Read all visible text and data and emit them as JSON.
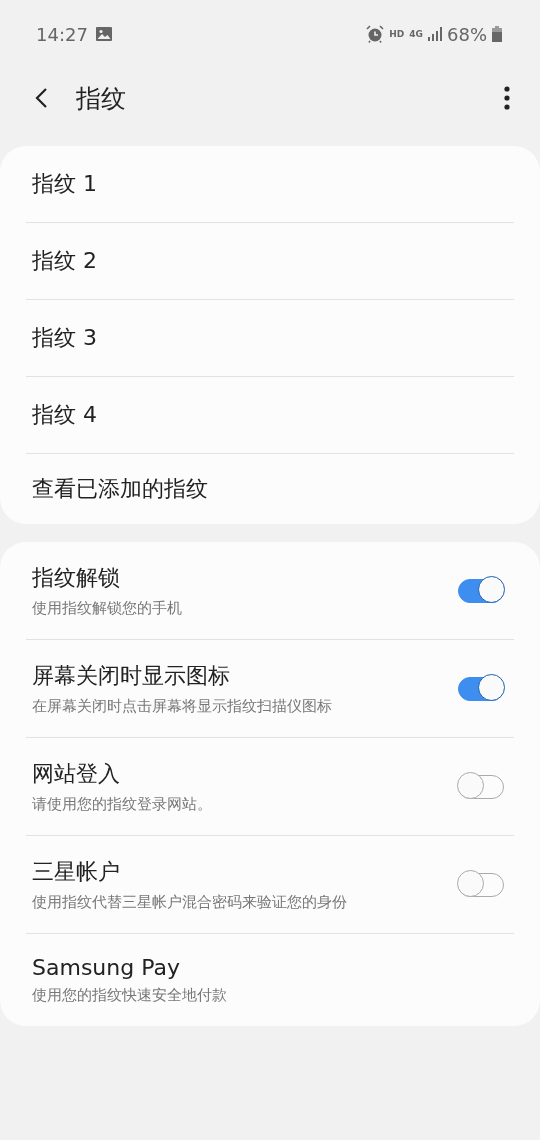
{
  "status_bar": {
    "time": "14:27",
    "hd": "HD",
    "network": "4G",
    "battery": "68%"
  },
  "header": {
    "title": "指纹"
  },
  "fingerprints": [
    {
      "label": "指纹 1"
    },
    {
      "label": "指纹 2"
    },
    {
      "label": "指纹 3"
    },
    {
      "label": "指纹 4"
    },
    {
      "label": "查看已添加的指纹"
    }
  ],
  "settings": [
    {
      "kind": "toggle",
      "title": "指纹解锁",
      "subtitle": "使用指纹解锁您的手机",
      "on": true
    },
    {
      "kind": "toggle",
      "title": "屏幕关闭时显示图标",
      "subtitle": "在屏幕关闭时点击屏幕将显示指纹扫描仪图标",
      "on": true
    },
    {
      "kind": "toggle",
      "title": "网站登入",
      "subtitle": "请使用您的指纹登录网站。",
      "on": false
    },
    {
      "kind": "toggle",
      "title": "三星帐户",
      "subtitle": "使用指纹代替三星帐户混合密码来验证您的身份",
      "on": false
    },
    {
      "kind": "plain",
      "title": "Samsung Pay",
      "subtitle": "使用您的指纹快速安全地付款"
    }
  ]
}
